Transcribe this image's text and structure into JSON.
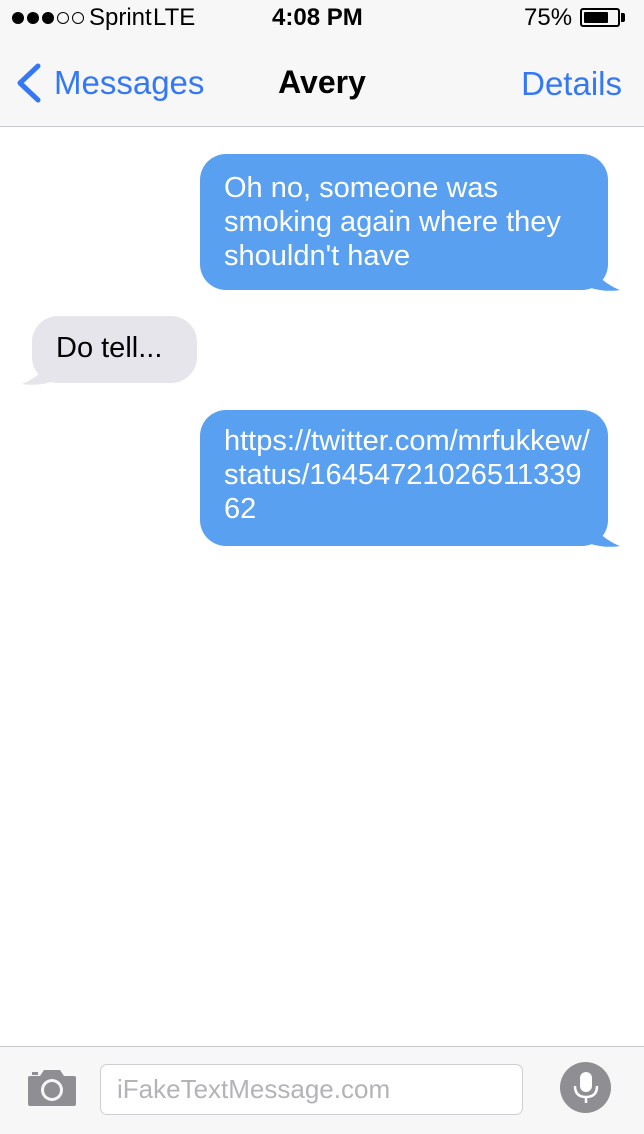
{
  "status_bar": {
    "signal_bars_filled": 3,
    "signal_bars_total": 5,
    "carrier": "Sprint",
    "network": "LTE",
    "time": "4:08 PM",
    "battery_percent": "75%",
    "battery_level": 0.75
  },
  "nav": {
    "back_label": "Messages",
    "title": "Avery",
    "details_label": "Details"
  },
  "messages": [
    {
      "direction": "sent",
      "text": "Oh no, someone was smoking again where they shouldn't have"
    },
    {
      "direction": "received",
      "text": "Do tell..."
    },
    {
      "direction": "sent",
      "text": "https://twitter.com/mrfukkew/status/1645472102651133962"
    }
  ],
  "input": {
    "placeholder": "iFakeTextMessage.com"
  },
  "icons": {
    "back": "chevron-left-icon",
    "camera": "camera-icon",
    "mic": "microphone-icon"
  },
  "colors": {
    "accent": "#3478f6",
    "sent_bubble": "#5aa0f0",
    "received_bubble": "#e6e5eb",
    "bar_background": "#f7f7f8"
  }
}
